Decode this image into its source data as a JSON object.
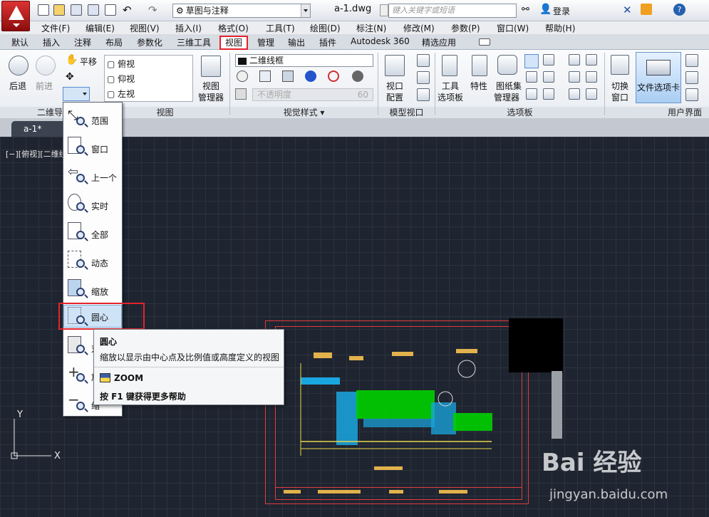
{
  "titlebar": {
    "workspace": "草图与注释",
    "document": "a-1.dwg",
    "search_placeholder": "键入关键字或短语",
    "login": "登录"
  },
  "menubar": [
    "文件(F)",
    "编辑(E)",
    "视图(V)",
    "插入(I)",
    "格式(O)",
    "工具(T)",
    "绘图(D)",
    "标注(N)",
    "修改(M)",
    "参数(P)",
    "窗口(W)",
    "帮助(H)"
  ],
  "ribbon_tabs": [
    "默认",
    "插入",
    "注释",
    "布局",
    "参数化",
    "三维工具",
    "视图",
    "管理",
    "输出",
    "插件",
    "Autodesk 360",
    "精选应用"
  ],
  "active_tab": "视图",
  "ribbon": {
    "back": "后退",
    "forward": "前进",
    "pan": "平移",
    "views": [
      "俯视",
      "仰视",
      "左视"
    ],
    "view_manager_line1": "视图",
    "view_manager_line2": "管理器",
    "visual_style": "二维线框",
    "opacity_label": "不透明度",
    "opacity_value": "60",
    "viewport_config_line1": "视口",
    "viewport_config_line2": "配置",
    "tool_palette_line1": "工具",
    "tool_palette_line2": "选项板",
    "properties": "特性",
    "sheetset_line1": "图纸集",
    "sheetset_line2": "管理器",
    "switch_window_line1": "切换",
    "switch_window_line2": "窗口",
    "file_tabs": "文件选项卡",
    "panels": {
      "nav2d": "二维导",
      "view": "视图",
      "visual_styles": "视觉样式",
      "model_viewports": "模型视口",
      "palettes": "选项板",
      "ui": "用户界面"
    }
  },
  "doc_tab": "a-1*",
  "viewport_controls": "[−][俯视][二维线",
  "zoom_menu": {
    "items": [
      "范围",
      "窗口",
      "上一个",
      "实时",
      "全部",
      "动态",
      "缩放",
      "圆心",
      "对",
      "放",
      "缩"
    ]
  },
  "tooltip": {
    "title": "圆心",
    "description": "缩放以显示由中心点及比例值或高度定义的视图",
    "command": "ZOOM",
    "help": "按 F1 键获得更多帮助"
  },
  "ucs": {
    "x": "X",
    "y": "Y"
  },
  "watermark": {
    "brand": "Bai 经验",
    "url": "jingyan.baidu.com"
  },
  "colors": {
    "highlight_red": "#e3232c",
    "canvas_bg": "#1f2530",
    "hatch_green": "#00e000",
    "hatch_blue": "#1aa7e0"
  }
}
